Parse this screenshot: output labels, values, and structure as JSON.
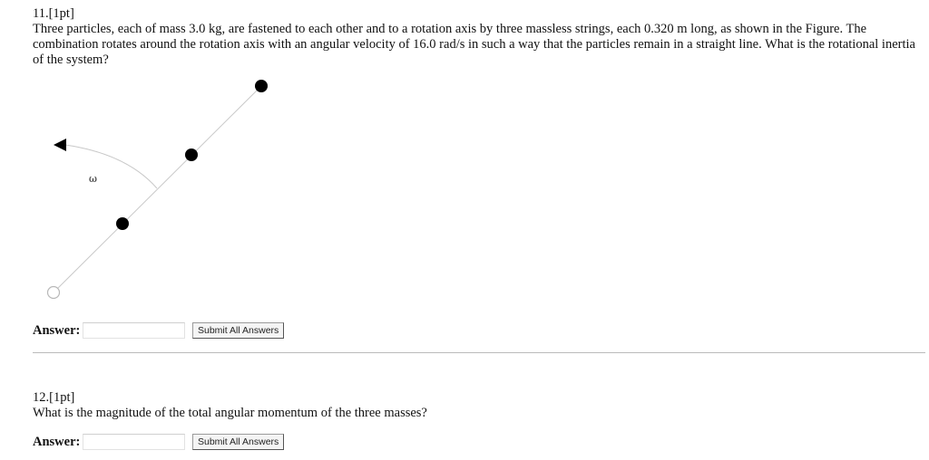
{
  "problem11": {
    "number": "11.[1pt]",
    "text": "Three particles, each of mass 3.0 kg, are fastened to each other and to a rotation axis by three massless strings, each 0.320 m long, as shown in the Figure. The combination rotates around the rotation axis with an angular velocity of 16.0 rad/s in such a way that the particles remain in a straight line. What is the rotational inertia of the system?",
    "figure": {
      "omega_label": "ω"
    },
    "answer_label": "Answer:",
    "answer_value": "",
    "submit_label": "Submit All Answers"
  },
  "problem12": {
    "number": "12.[1pt]",
    "text": "What is the magnitude of the total angular momentum of the three masses?",
    "answer_label": "Answer:",
    "answer_value": "",
    "submit_label": "Submit All Answers"
  },
  "colors": {
    "line": "#c8c8c8",
    "particle": "#000000",
    "pivot_fill": "#ffffff",
    "pivot_stroke": "#b8b8b8"
  }
}
